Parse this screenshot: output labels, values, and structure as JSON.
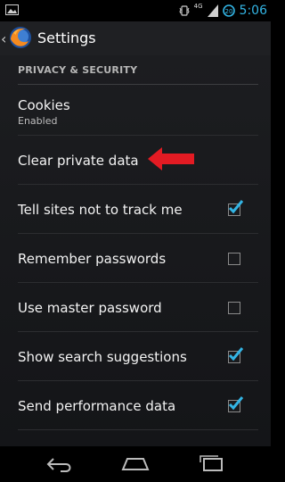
{
  "status": {
    "time": "5:06",
    "network": "4G",
    "time_color": "#33b5e5"
  },
  "action_bar": {
    "title": "Settings",
    "icon": "firefox-logo-icon"
  },
  "section": {
    "header": "PRIVACY & SECURITY"
  },
  "settings": [
    {
      "title": "Cookies",
      "summary": "Enabled",
      "checkbox": null
    },
    {
      "title": "Clear private data",
      "summary": "",
      "checkbox": null
    },
    {
      "title": "Tell sites not to track me",
      "checkbox": true
    },
    {
      "title": "Remember passwords",
      "checkbox": false
    },
    {
      "title": "Use master password",
      "checkbox": false
    },
    {
      "title": "Show search suggestions",
      "checkbox": true
    },
    {
      "title": "Send performance data",
      "checkbox": true
    }
  ],
  "colors": {
    "accent": "#33b5e5",
    "annotation_arrow": "#e31b23"
  },
  "nav": {
    "icons": [
      "back-icon",
      "home-icon",
      "recent-apps-icon"
    ]
  }
}
